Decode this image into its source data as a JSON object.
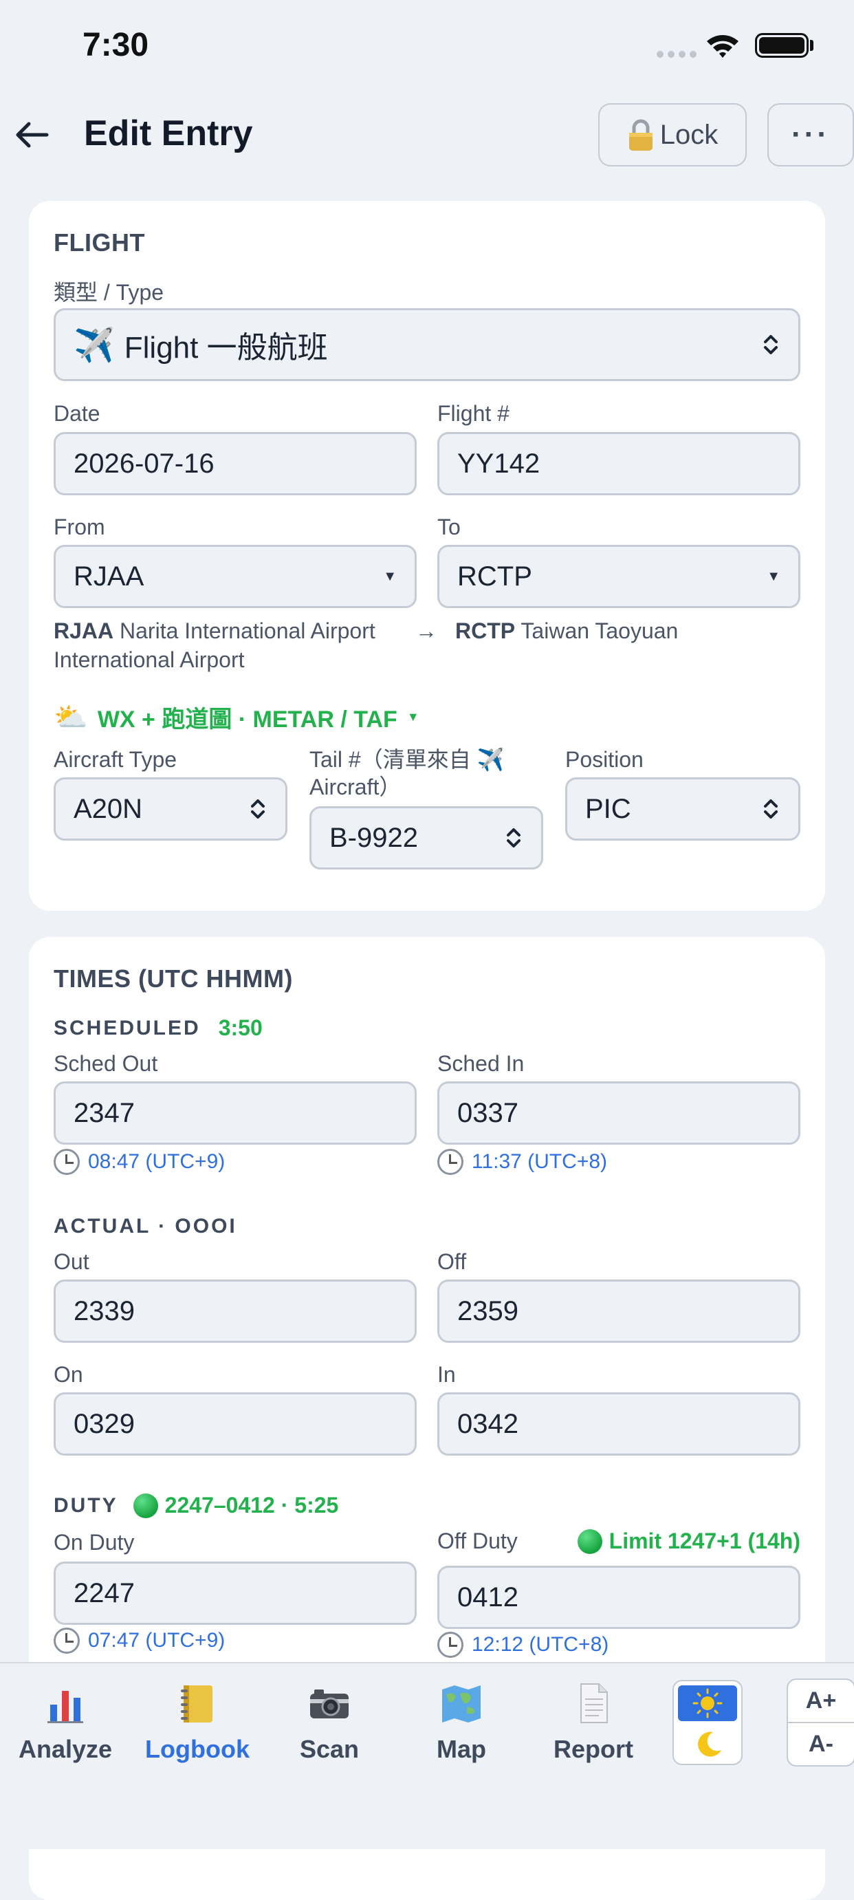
{
  "status": {
    "time": "7:30"
  },
  "header": {
    "title": "Edit Entry",
    "lock_label": "Lock",
    "more_label": "···"
  },
  "flight": {
    "section_title": "FLIGHT",
    "type_label": "類型 / Type",
    "type_value": "Flight 一般航班",
    "date_label": "Date",
    "date_value": "2026-07-16",
    "flight_no_label": "Flight #",
    "flight_no_value": "YY142",
    "from_label": "From",
    "from_value": "RJAA",
    "to_label": "To",
    "to_value": "RCTP",
    "route_from_code": "RJAA",
    "route_from_name": "Narita International Airport",
    "route_arrow": "→",
    "route_to_code": "RCTP",
    "route_to_name": "Taiwan Taoyuan",
    "route_to_name_line2": "International Airport",
    "wx_label": "WX + 跑道圖 · METAR / TAF",
    "aircraft_type_label": "Aircraft Type",
    "aircraft_type_value": "A20N",
    "tail_label": "Tail #（清單來自 ✈️",
    "tail_label_line2": "Aircraft）",
    "tail_value": "B-9922",
    "position_label": "Position",
    "position_value": "PIC"
  },
  "times": {
    "section_title": "TIMES (UTC HHMM)",
    "scheduled_title": "SCHEDULED",
    "scheduled_block": "3:50",
    "sched_out_label": "Sched Out",
    "sched_out_value": "2347",
    "sched_out_local": "08:47 (UTC+9)",
    "sched_in_label": "Sched In",
    "sched_in_value": "0337",
    "sched_in_local": "11:37 (UTC+8)",
    "actual_title": "ACTUAL · OOOI",
    "out_label": "Out",
    "out_value": "2339",
    "off_label": "Off",
    "off_value": "2359",
    "on_label": "On",
    "on_value": "0329",
    "in_label": "In",
    "in_value": "0342",
    "duty_title": "DUTY",
    "duty_summary": "2247–0412 · 5:25",
    "on_duty_label": "On Duty",
    "on_duty_value": "2247",
    "on_duty_local": "07:47 (UTC+9)",
    "off_duty_label": "Off Duty",
    "off_duty_limit": "Limit 1247+1 (14h)",
    "off_duty_value": "0412",
    "off_duty_local": "12:12 (UTC+8)"
  },
  "tabs": [
    {
      "label": "Analyze",
      "icon": "bar-chart-icon"
    },
    {
      "label": "Logbook",
      "icon": "notebook-icon"
    },
    {
      "label": "Scan",
      "icon": "camera-icon"
    },
    {
      "label": "Map",
      "icon": "world-map-icon"
    },
    {
      "label": "Report",
      "icon": "document-icon"
    }
  ],
  "font_controls": {
    "increase": "A+",
    "decrease": "A-"
  },
  "colors": {
    "accent": "#2f6fde",
    "success": "#22b14c",
    "card": "#ffffff",
    "background": "#eef1f6"
  }
}
